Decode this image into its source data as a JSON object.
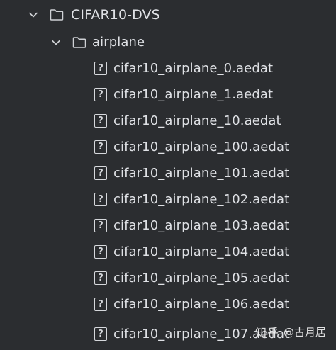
{
  "tree": {
    "root": {
      "label": "CIFAR10-DVS",
      "expanded": true,
      "chevron_icon": "chevron-down-icon",
      "icon": "folder-icon"
    },
    "subfolder": {
      "label": "airplane",
      "expanded": true,
      "chevron_icon": "chevron-down-icon",
      "icon": "folder-icon"
    },
    "file_icon": "unknown-file-icon",
    "file_icon_glyph": "?",
    "files": [
      "cifar10_airplane_0.aedat",
      "cifar10_airplane_1.aedat",
      "cifar10_airplane_10.aedat",
      "cifar10_airplane_100.aedat",
      "cifar10_airplane_101.aedat",
      "cifar10_airplane_102.aedat",
      "cifar10_airplane_103.aedat",
      "cifar10_airplane_104.aedat",
      "cifar10_airplane_105.aedat",
      "cifar10_airplane_106.aedat",
      "cifar10_airplane_107.aedat"
    ]
  },
  "watermark": {
    "brand": "知乎",
    "user": "@古月居"
  },
  "colors": {
    "background": "#2b2d30",
    "text": "#dfe1e5",
    "icon": "#d6d8dc"
  }
}
